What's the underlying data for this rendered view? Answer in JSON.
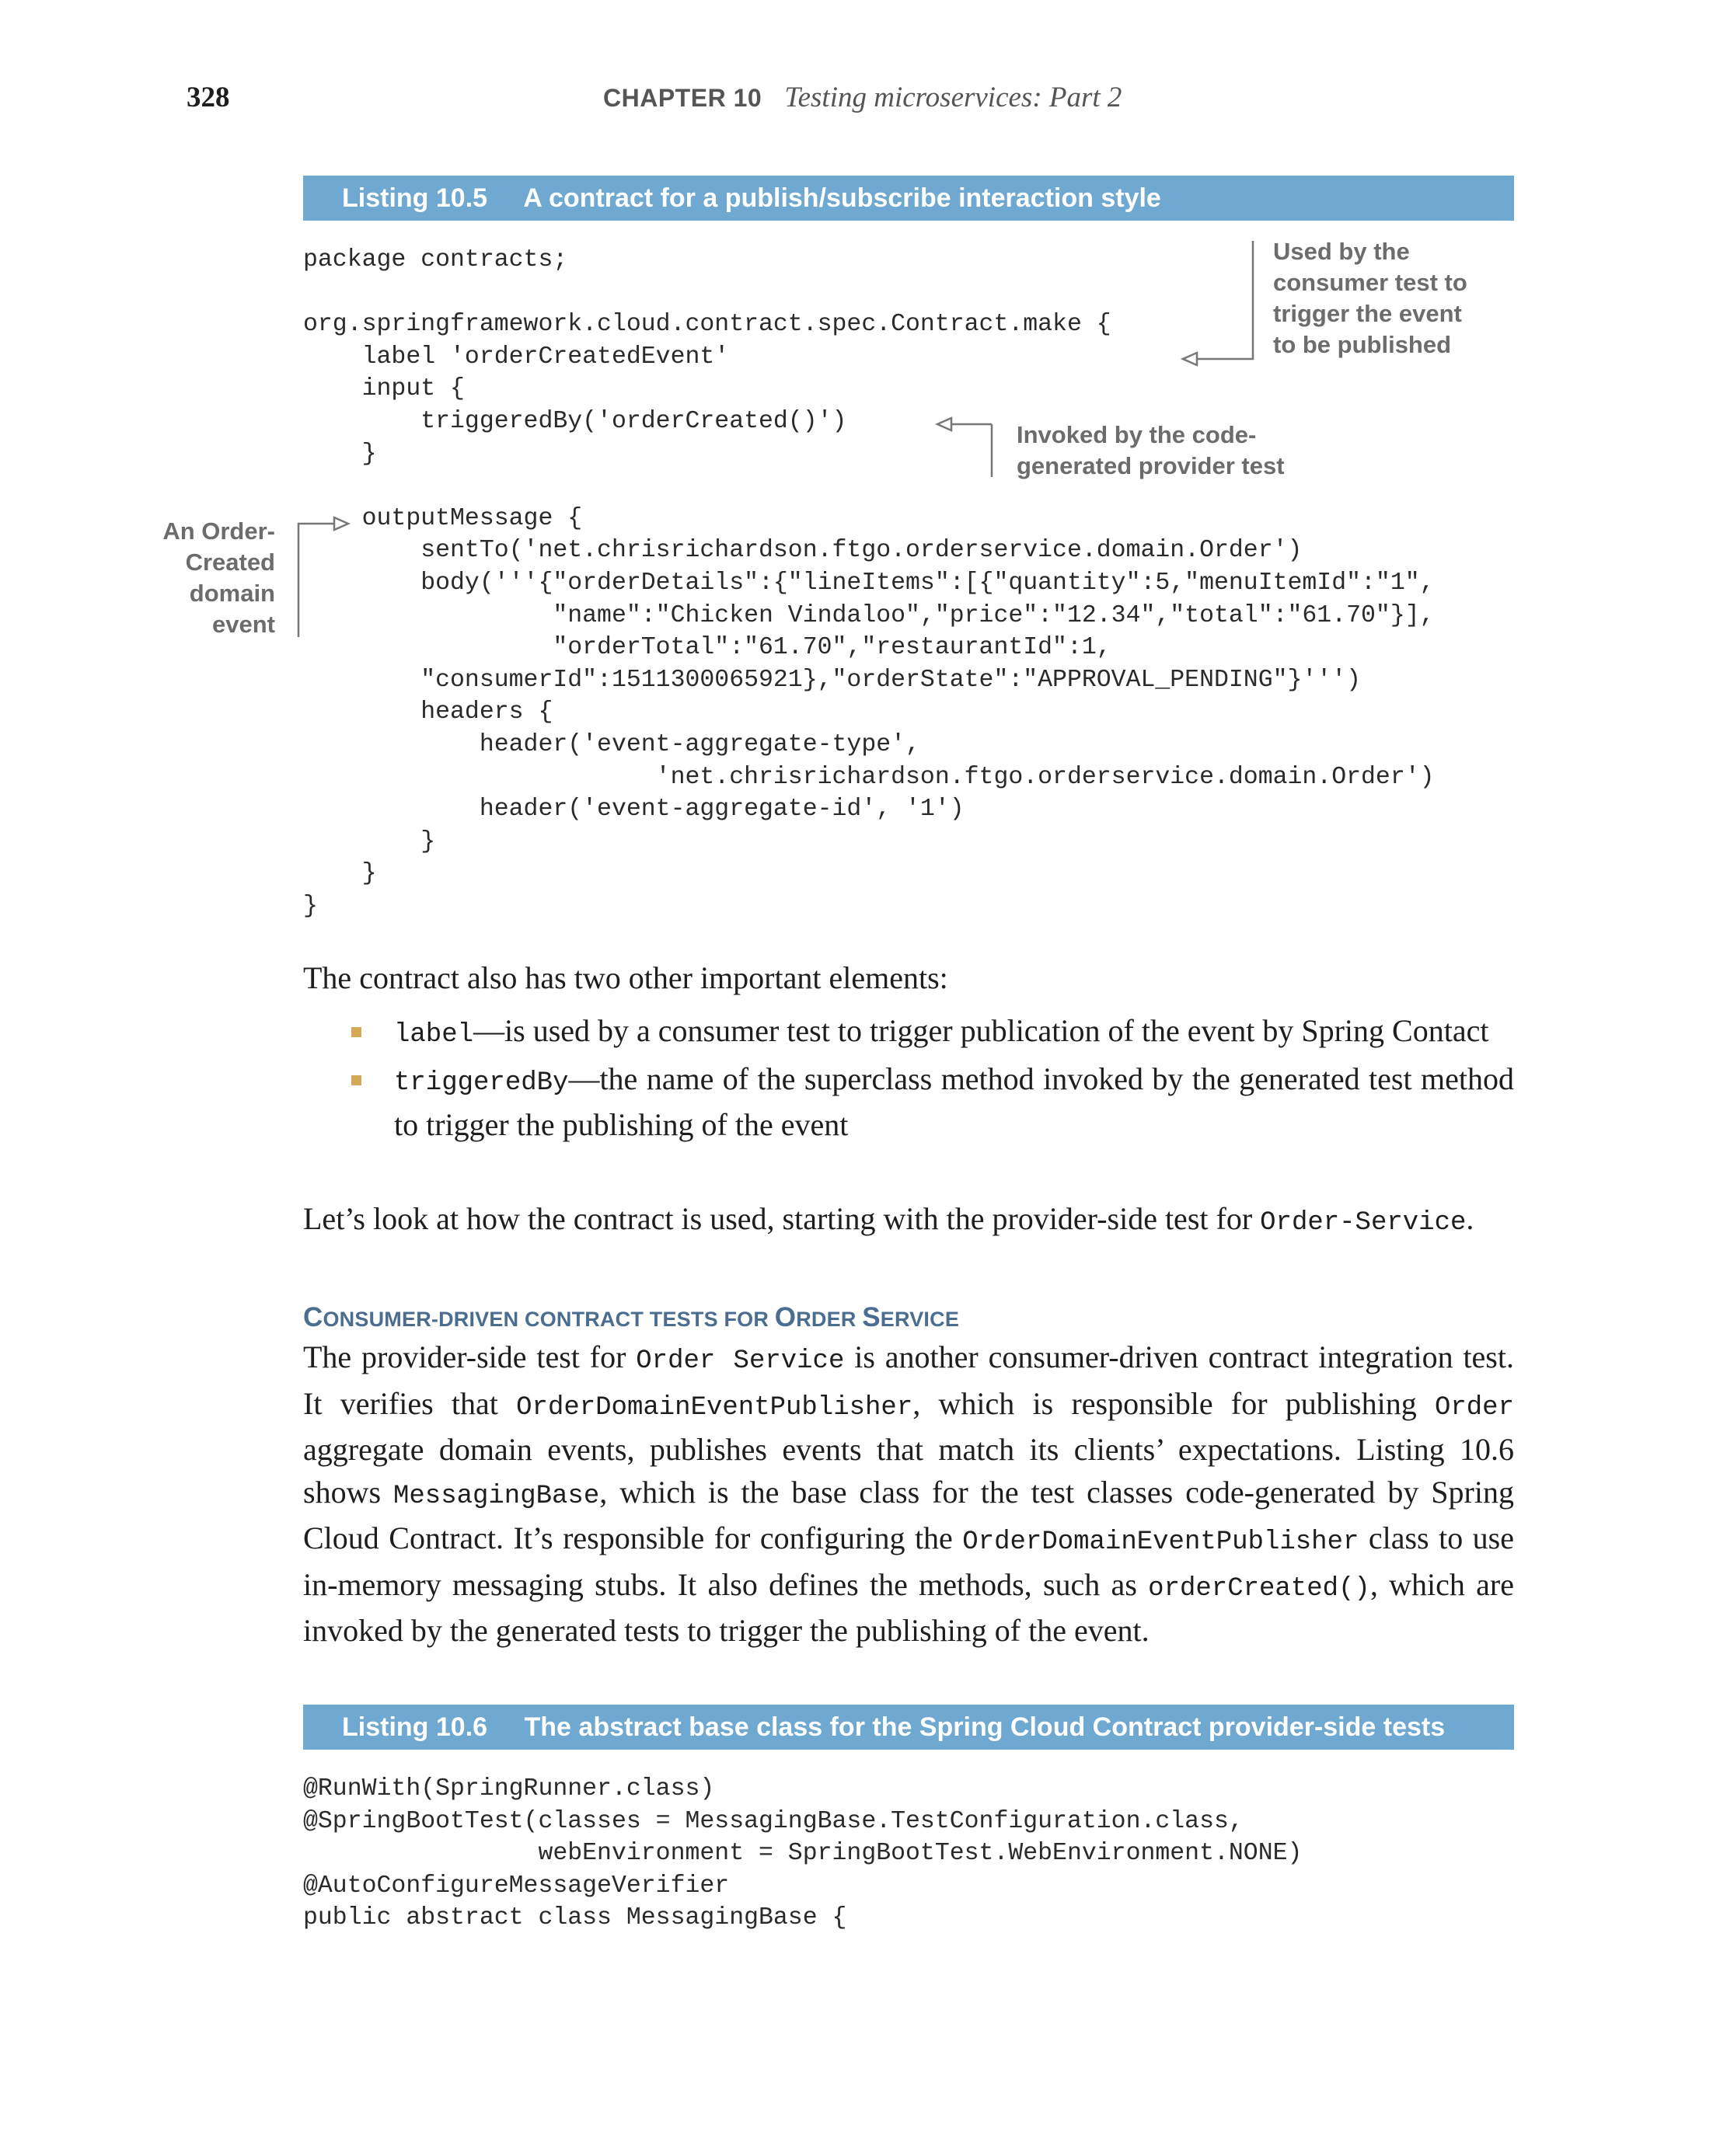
{
  "header": {
    "page_number": "328",
    "chapter_label": "Chapter 10",
    "chapter_title": "Testing microservices: Part 2"
  },
  "listing_10_5": {
    "number": "Listing 10.5",
    "title": "A contract for a publish/subscribe interaction style",
    "code": "package contracts;\n\norg.springframework.cloud.contract.spec.Contract.make {\n    label 'orderCreatedEvent'\n    input {\n        triggeredBy('orderCreated()')\n    }\n\n    outputMessage {\n        sentTo('net.chrisrichardson.ftgo.orderservice.domain.Order')\n        body('''{\"orderDetails\":{\"lineItems\":[{\"quantity\":5,\"menuItemId\":\"1\",\n                 \"name\":\"Chicken Vindaloo\",\"price\":\"12.34\",\"total\":\"61.70\"}],\n                 \"orderTotal\":\"61.70\",\"restaurantId\":1,\n        \"consumerId\":1511300065921},\"orderState\":\"APPROVAL_PENDING\"}''')\n        headers {\n            header('event-aggregate-type',\n                        'net.chrisrichardson.ftgo.orderservice.domain.Order')\n            header('event-aggregate-id', '1')\n        }\n    }\n}",
    "annotations": {
      "used_by_consumer": [
        "Used by the",
        "consumer test to",
        "trigger the event",
        "to be published"
      ],
      "invoked_by_provider": [
        "Invoked by the code-",
        "generated provider test"
      ],
      "domain_event": [
        "An Order-",
        "Created",
        "domain",
        "event"
      ]
    }
  },
  "body": {
    "intro": "The contract also has two other important elements:",
    "bullets": [
      {
        "code": "label",
        "text": "—is used by a consumer test to trigger publication of the event by Spring Contact"
      },
      {
        "code": "triggeredBy",
        "text": "—the name of the superclass method invoked by the generated test method to trigger the publishing of the event"
      }
    ],
    "lets_look_a": "Let’s look at how the contract is used, starting with the provider-side test for ",
    "lets_look_code": "Order-Service",
    "lets_look_b": ".",
    "subhead": {
      "w1_cap": "C",
      "w1_rest": "ONSUMER",
      "w2": "-DRIVEN CONTRACT TESTS FOR ",
      "w3_cap": "O",
      "w3_rest": "RDER ",
      "w4_cap": "S",
      "w4_rest": "ERVICE"
    },
    "para": {
      "t1": "The provider-side test for ",
      "c1": "Order Service",
      "t2": " is another consumer-driven contract integration test. It verifies that ",
      "c2": "OrderDomainEventPublisher",
      "t3": ", which is responsible for publishing ",
      "c3": "Order",
      "t4": " aggregate domain events, publishes events that match its clients’ expectations. Listing 10.6 shows ",
      "c4": "MessagingBase",
      "t5": ", which is the base class for the test classes code-generated by Spring Cloud Contract. It’s responsible for configuring the ",
      "c5": "OrderDomainEventPublisher",
      "t6": " class to use in-memory messaging stubs. It also defines the methods, such as ",
      "c6": "orderCreated()",
      "t7": ", which are invoked by the generated tests to trigger the publishing of the event."
    }
  },
  "listing_10_6": {
    "number": "Listing 10.6",
    "title": "The abstract base class for the Spring Cloud Contract provider-side tests",
    "code": "@RunWith(SpringRunner.class)\n@SpringBootTest(classes = MessagingBase.TestConfiguration.class,\n                webEnvironment = SpringBootTest.WebEnvironment.NONE)\n@AutoConfigureMessageVerifier\npublic abstract class MessagingBase {"
  }
}
